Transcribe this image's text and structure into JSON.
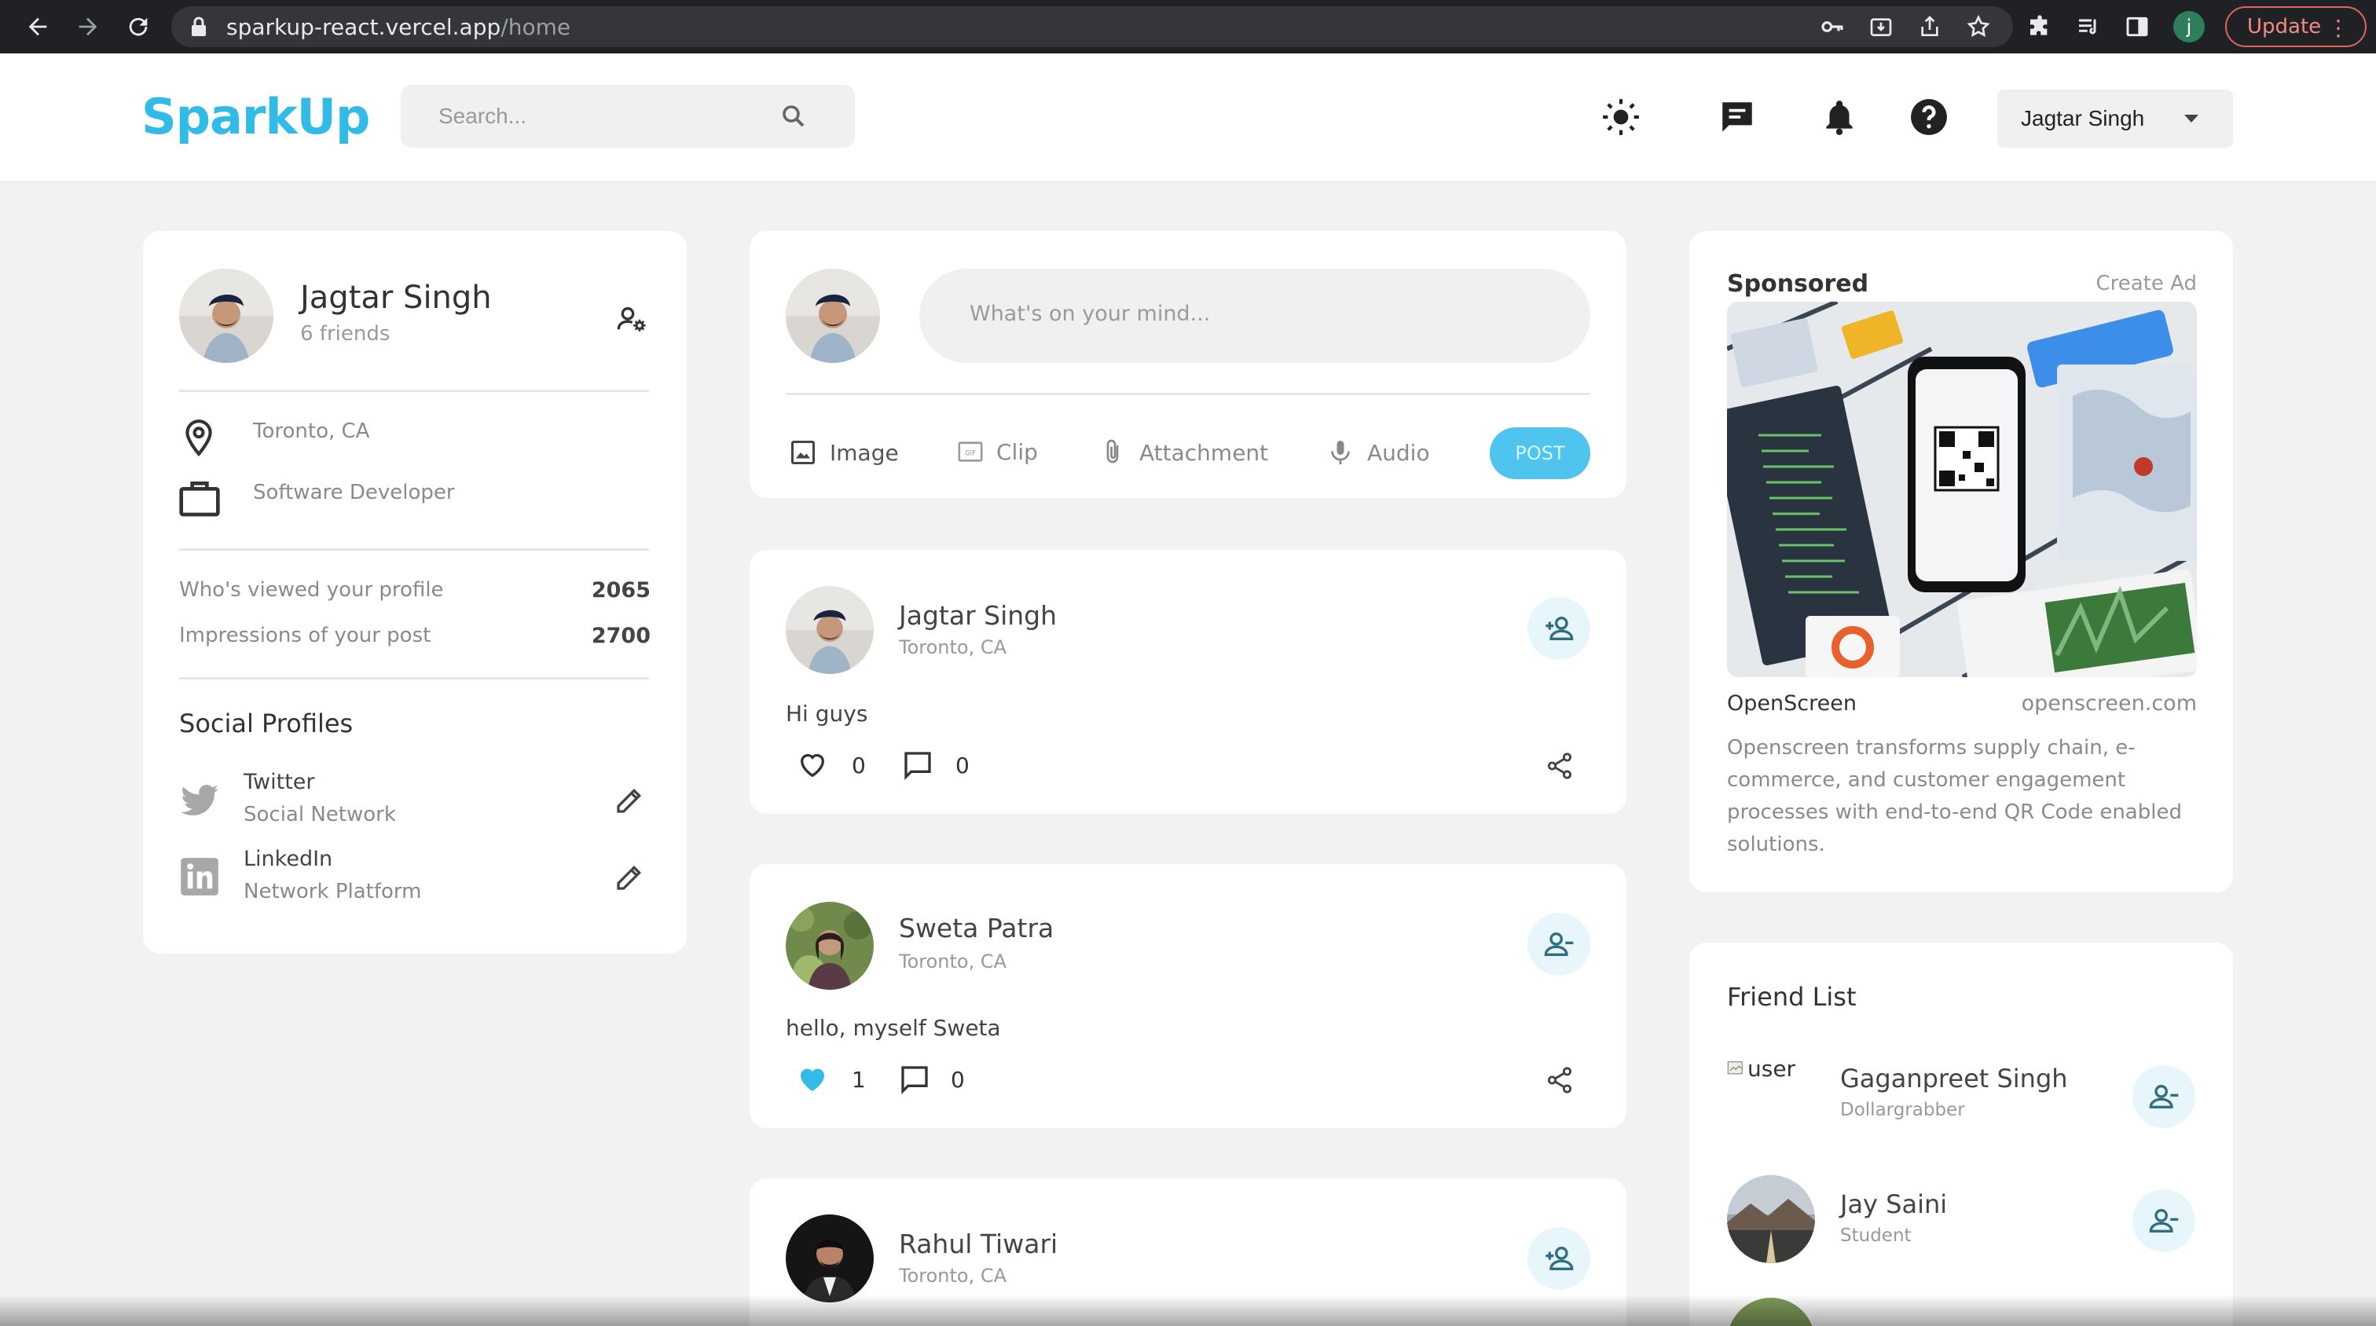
{
  "browser": {
    "url_host": "sparkup-react.vercel.app",
    "url_path": "/home",
    "profile_initial": "j",
    "update_label": "Update"
  },
  "nav": {
    "logo": "SparkUp",
    "search_placeholder": "Search...",
    "user_name": "Jagtar Singh"
  },
  "profile": {
    "name": "Jagtar Singh",
    "friends": "6 friends",
    "location": "Toronto, CA",
    "occupation": "Software Developer",
    "stats": [
      {
        "label": "Who's viewed your profile",
        "value": "2065"
      },
      {
        "label": "Impressions of your post",
        "value": "2700"
      }
    ],
    "social_title": "Social Profiles",
    "socials": [
      {
        "name": "Twitter",
        "type": "Social Network"
      },
      {
        "name": "LinkedIn",
        "type": "Network Platform"
      }
    ]
  },
  "composer": {
    "placeholder": "What's on your mind...",
    "actions": [
      "Image",
      "Clip",
      "Attachment",
      "Audio"
    ],
    "post_label": "POST"
  },
  "posts": [
    {
      "name": "Jagtar Singh",
      "location": "Toronto, CA",
      "text": "Hi guys",
      "likes": "0",
      "comments": "0",
      "liked": false
    },
    {
      "name": "Sweta Patra",
      "location": "Toronto, CA",
      "text": "hello, myself Sweta",
      "likes": "1",
      "comments": "0",
      "liked": true
    },
    {
      "name": "Rahul Tiwari",
      "location": "Toronto, CA",
      "text": "",
      "likes": "",
      "comments": "",
      "liked": false
    }
  ],
  "sponsored": {
    "title": "Sponsored",
    "create_ad": "Create Ad",
    "company": "OpenScreen",
    "website": "openscreen.com",
    "description_lines": [
      "Openscreen transforms supply chain, e-",
      "commerce, and customer engagement",
      "processes with end-to-end QR Code enabled",
      "solutions."
    ]
  },
  "friends": {
    "title": "Friend List",
    "broken_image_alt": "user",
    "items": [
      {
        "name": "Gaganpreet Singh",
        "role": "Dollargrabber"
      },
      {
        "name": "Jay Saini",
        "role": "Student"
      }
    ]
  },
  "colors": {
    "accent": "#33bbe8",
    "accent_light": "#e7f6fb",
    "background": "#f2f2f2",
    "card": "#ffffff",
    "like_active": "#33bbe8"
  }
}
